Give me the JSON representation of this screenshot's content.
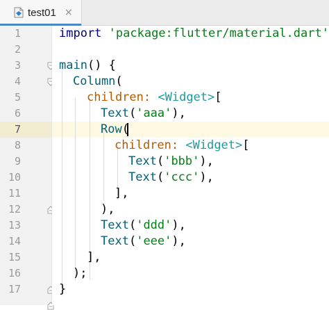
{
  "tab": {
    "title": "test01",
    "close_label": "×"
  },
  "line_numbers": [
    "1",
    "2",
    "3",
    "4",
    "5",
    "6",
    "7",
    "8",
    "9",
    "10",
    "11",
    "12",
    "13",
    "14",
    "15",
    "16",
    "17"
  ],
  "code": {
    "l1_kw": "import",
    "l1_str": "'package:flutter/material.dart'",
    "l1_end": ";",
    "l3_fn": "main",
    "l3_rest": "() {",
    "l4_fn": "Column",
    "l4_rest": "(",
    "l5_param": "children",
    "l5_colon": ": ",
    "l5_type": "<Widget>",
    "l5_rest": "[",
    "l6_fn": "Text",
    "l6_open": "(",
    "l6_str": "'aaa'",
    "l6_close": "),",
    "l7_fn": "Row",
    "l7_rest": "(",
    "l8_param": "children",
    "l8_colon": ": ",
    "l8_type": "<Widget>",
    "l8_rest": "[",
    "l9_fn": "Text",
    "l9_open": "(",
    "l9_str": "'bbb'",
    "l9_close": "),",
    "l10_fn": "Text",
    "l10_open": "(",
    "l10_str": "'ccc'",
    "l10_close": "),",
    "l11": "],",
    "l12": "),",
    "l13_fn": "Text",
    "l13_open": "(",
    "l13_str": "'ddd'",
    "l13_close": "),",
    "l14_fn": "Text",
    "l14_open": "(",
    "l14_str": "'eee'",
    "l14_close": "),",
    "l15": "],",
    "l16": ");",
    "l17": "}"
  },
  "colors": {
    "keyword": "#000080",
    "string": "#067d17",
    "function": "#00627a",
    "named_param": "#b35c00",
    "type": "#20999d",
    "current_line": "#fdf9e2",
    "tab_accent": "#4a88c7"
  },
  "icons": {
    "file": "dart-file-icon",
    "intention": "lightbulb-icon",
    "fold": "fold-marker-icon"
  }
}
